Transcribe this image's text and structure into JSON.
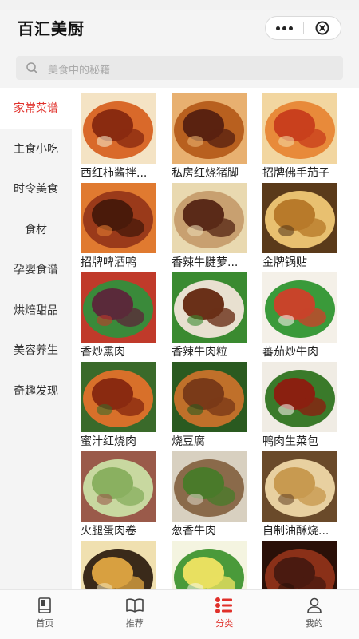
{
  "app": {
    "title": "百汇美厨"
  },
  "search": {
    "placeholder": "美食中的秘籍"
  },
  "sidebar": {
    "items": [
      {
        "label": "家常菜谱",
        "active": true
      },
      {
        "label": "主食小吃",
        "active": false
      },
      {
        "label": "时令美食",
        "active": false
      },
      {
        "label": "食材",
        "active": false
      },
      {
        "label": "孕婴食谱",
        "active": false
      },
      {
        "label": "烘焙甜品",
        "active": false
      },
      {
        "label": "美容养生",
        "active": false
      },
      {
        "label": "奇趣发现",
        "active": false
      }
    ]
  },
  "recipes": [
    {
      "name": "西红柿酱拌...",
      "colors": [
        "#8a2b10",
        "#d9692a",
        "#f4e3c4"
      ]
    },
    {
      "name": "私房红烧猪脚",
      "colors": [
        "#5a2210",
        "#b8601f",
        "#e8b070"
      ]
    },
    {
      "name": "招牌佛手茄子",
      "colors": [
        "#c9401d",
        "#e88a3a",
        "#f2d6a0"
      ]
    },
    {
      "name": "招牌啤酒鸭",
      "colors": [
        "#4a1a0a",
        "#9a3a1a",
        "#e07a30"
      ]
    },
    {
      "name": "香辣牛腱萝...",
      "colors": [
        "#5a2a18",
        "#c8a070",
        "#e9d9b0"
      ]
    },
    {
      "name": "金牌锅贴",
      "colors": [
        "#b87a2a",
        "#e8c070",
        "#5a3a1a"
      ]
    },
    {
      "name": "香炒熏肉",
      "colors": [
        "#5a2a3a",
        "#3a8a3a",
        "#c03a2a"
      ]
    },
    {
      "name": "香辣牛肉粒",
      "colors": [
        "#6a3018",
        "#e8e0d0",
        "#3a8a30"
      ]
    },
    {
      "name": "蕃茄炒牛肉",
      "colors": [
        "#c8442a",
        "#3a9a3a",
        "#f4f0e8"
      ]
    },
    {
      "name": "蜜汁红烧肉",
      "colors": [
        "#8a2a10",
        "#d8702a",
        "#3a6a2a"
      ]
    },
    {
      "name": "烧豆腐",
      "colors": [
        "#7a3a18",
        "#c0702a",
        "#2a5a20"
      ]
    },
    {
      "name": "鸭肉生菜包",
      "colors": [
        "#8a2010",
        "#3a7a2a",
        "#f0ece4"
      ]
    },
    {
      "name": "火腿蛋肉卷",
      "colors": [
        "#8ab060",
        "#c8d8a0",
        "#9a5a4a"
      ]
    },
    {
      "name": "葱香牛肉",
      "colors": [
        "#4a7a2a",
        "#8a6a4a",
        "#d8d0c0"
      ]
    },
    {
      "name": "自制油酥烧...",
      "colors": [
        "#c89a50",
        "#e8d0a0",
        "#6a4a2a"
      ]
    },
    {
      "name": "",
      "colors": [
        "#d8a040",
        "#3a2a1a",
        "#f0e0b0"
      ]
    },
    {
      "name": "",
      "colors": [
        "#e8e060",
        "#4a9a3a",
        "#f4f4e0"
      ]
    },
    {
      "name": "",
      "colors": [
        "#4a1a10",
        "#8a3018",
        "#2a1008"
      ]
    }
  ],
  "tabbar": {
    "tabs": [
      {
        "label": "首页",
        "icon": "book-icon",
        "active": false
      },
      {
        "label": "推荐",
        "icon": "open-book-icon",
        "active": false
      },
      {
        "label": "分类",
        "icon": "category-list-icon",
        "active": true
      },
      {
        "label": "我的",
        "icon": "user-icon",
        "active": false
      }
    ]
  },
  "colors": {
    "accent": "#e0302a",
    "sidebar_bg": "#f4f4f4",
    "search_bg": "#e9e9e9"
  }
}
